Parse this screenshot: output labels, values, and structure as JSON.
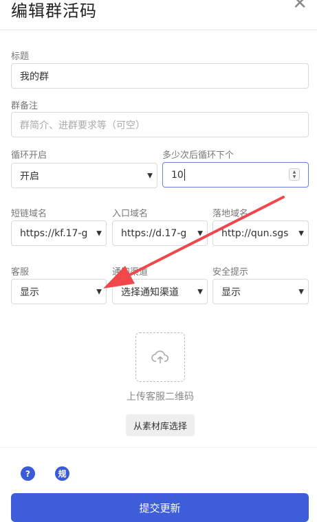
{
  "dialog": {
    "title": "编辑群活码",
    "close_icon": "close-icon"
  },
  "form": {
    "name": {
      "label": "标题",
      "value": "我的群"
    },
    "remark": {
      "label": "群备注",
      "placeholder": "群简介、进群要求等（可空）"
    },
    "loop": {
      "label": "循环开启",
      "value": "开启"
    },
    "loop_count": {
      "label": "多少次后循环下个",
      "value": "10"
    },
    "short_domain": {
      "label": "短链域名",
      "value": "https://kf.17-g"
    },
    "entry_domain": {
      "label": "入口域名",
      "value": "https://d.17-g"
    },
    "landing_domain": {
      "label": "落地域名",
      "value": "http://qun.sgs"
    },
    "service": {
      "label": "客服",
      "value": "显示"
    },
    "notify": {
      "label": "通知渠道",
      "value": "选择通知渠道"
    },
    "security": {
      "label": "安全提示",
      "value": "显示"
    }
  },
  "upload": {
    "icon": "cloud-upload-icon",
    "label": "上传客服二维码",
    "library_button": "从素材库选择"
  },
  "footer": {
    "help_icon": "?",
    "rules_icon": "规",
    "submit_label": "提交更新"
  },
  "annotation": {
    "arrow_color": "#f0474a"
  },
  "colors": {
    "primary": "#3d5ed8"
  }
}
